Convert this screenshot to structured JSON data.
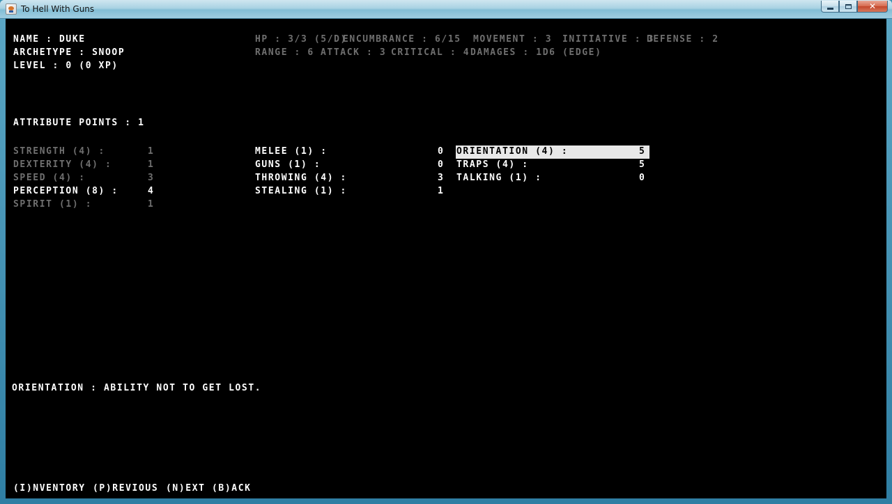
{
  "window": {
    "title": "To Hell With Guns",
    "min_glyph": "",
    "max_glyph": "",
    "close_glyph": "✕"
  },
  "character": {
    "name": "NAME : DUKE",
    "archetype": "ARCHETYPE : SNOOP",
    "level": "LEVEL : 0 (0 XP)"
  },
  "stats_line1": {
    "hp": "HP : 3/3 (5/D)",
    "encumbrance": "ENCUMBRANCE : 6/15",
    "movement": "MOVEMENT : 3",
    "initiative": "INITIATIVE : 3",
    "defense": "DEFENSE : 2"
  },
  "stats_line2": {
    "range": "RANGE : 6",
    "attack": "ATTACK : 3",
    "critical": "CRITICAL : 4",
    "damages": "DAMAGES : 1D6 (EDGE)"
  },
  "attribute_points": "ATTRIBUTE POINTS : 1",
  "attributes": [
    {
      "label": "STRENGTH (4) :",
      "value": "1"
    },
    {
      "label": "DEXTERITY (4) :",
      "value": "1"
    },
    {
      "label": "SPEED (4) :",
      "value": "3"
    },
    {
      "label": "PERCEPTION (8) :",
      "value": "4"
    },
    {
      "label": "SPIRIT (1) :",
      "value": "1"
    }
  ],
  "skills_col2": [
    {
      "label": "MELEE (1) :",
      "value": "0"
    },
    {
      "label": "GUNS (1) :",
      "value": "0"
    },
    {
      "label": "THROWING (4) :",
      "value": "3"
    },
    {
      "label": "STEALING (1) :",
      "value": "1"
    }
  ],
  "skills_col3": [
    {
      "label": "ORIENTATION (4) :",
      "value": "5"
    },
    {
      "label": "TRAPS (4) :",
      "value": "5"
    },
    {
      "label": "TALKING (1) :",
      "value": "0"
    }
  ],
  "description": "ORIENTATION : ABILITY NOT TO GET LOST.",
  "commands": {
    "inventory": "(I)NVENTORY",
    "previous": "(P)REVIOUS",
    "next": "(N)EXT",
    "back": "(B)ACK"
  },
  "colors": {
    "active_text": "#ffffff",
    "dim_text": "#6f6f6f",
    "highlight_bg": "#e8e8e8",
    "background": "#000000"
  }
}
